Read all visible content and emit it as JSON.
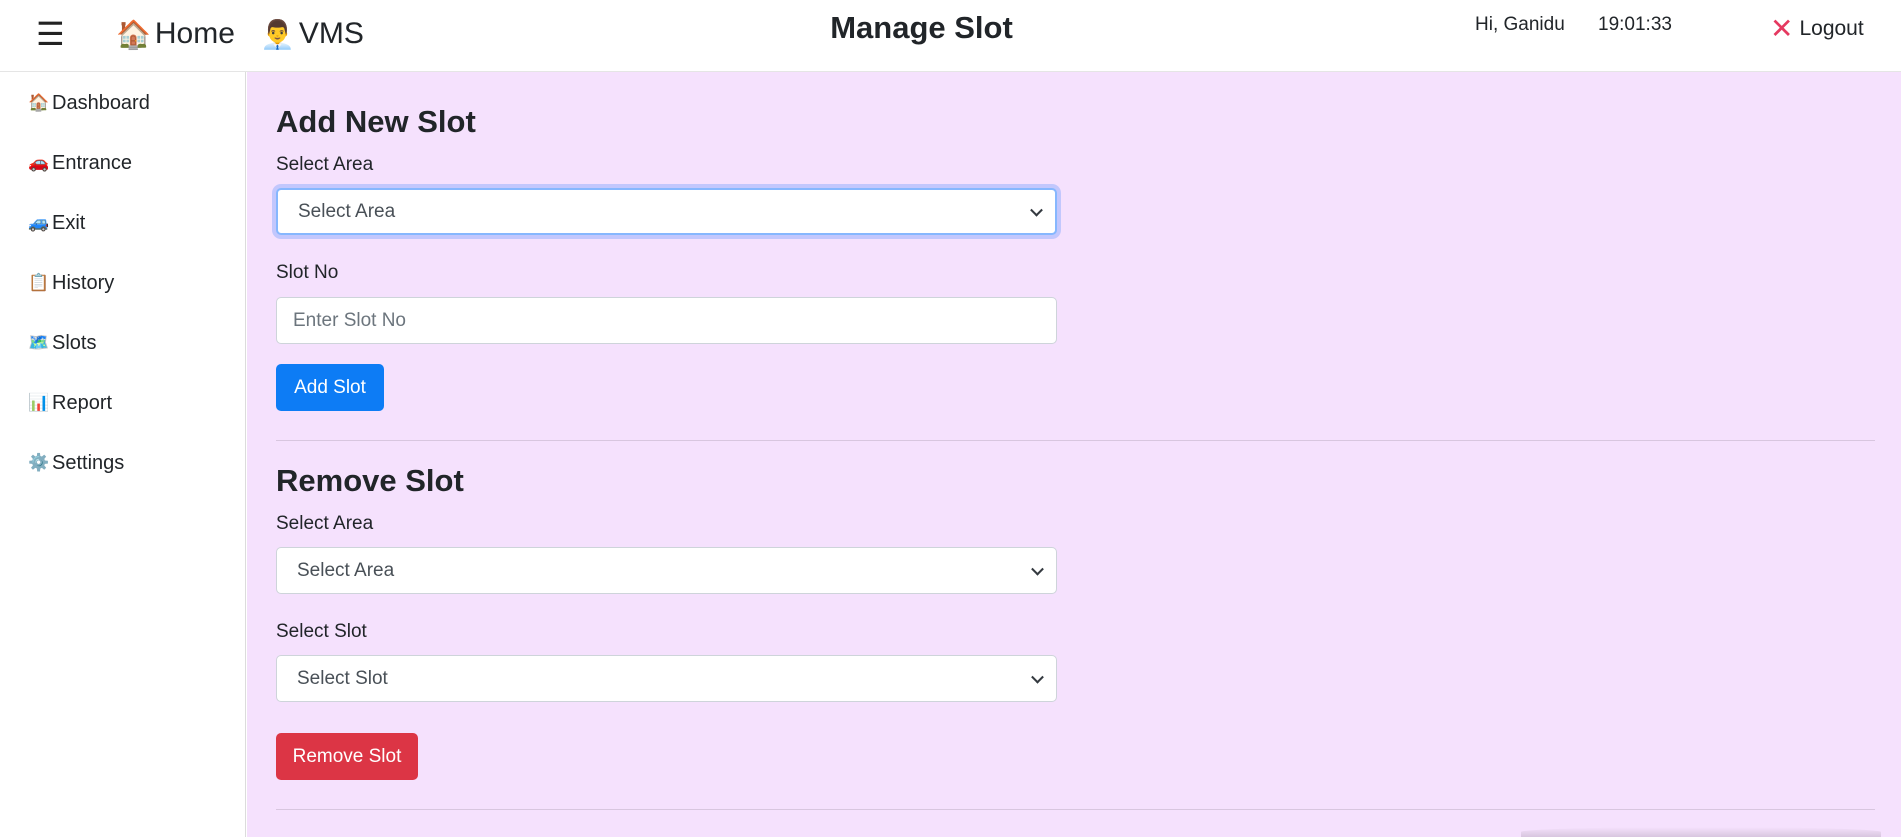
{
  "header": {
    "menu_icon": "hamburger-icon",
    "home": {
      "emoji": "🏠",
      "label": "Home"
    },
    "vms": {
      "emoji": "👨‍💼",
      "label": "VMS"
    },
    "title": "Manage Slot",
    "greeting": "Hi, Ganidu",
    "clock": "19:01:33",
    "logout": {
      "icon": "❌",
      "label": "Logout"
    }
  },
  "sidebar": {
    "items": [
      {
        "emoji": "🏠",
        "label": "Dashboard"
      },
      {
        "emoji": "🚗",
        "label": "Entrance"
      },
      {
        "emoji": "🚙",
        "label": "Exit"
      },
      {
        "emoji": "📋",
        "label": "History"
      },
      {
        "emoji": "🗺️",
        "label": "Slots"
      },
      {
        "emoji": "📊",
        "label": "Report"
      },
      {
        "emoji": "⚙️",
        "label": "Settings"
      }
    ]
  },
  "add_slot": {
    "title": "Add New Slot",
    "area_label": "Select Area",
    "area_value": "Select Area",
    "slot_label": "Slot No",
    "slot_placeholder": "Enter Slot No",
    "button": "Add Slot"
  },
  "remove_slot": {
    "title": "Remove Slot",
    "area_label": "Select Area",
    "area_value": "Select Area",
    "slot_label": "Select Slot",
    "slot_value": "Select Slot",
    "button": "Remove Slot"
  },
  "colors": {
    "main_background": "#f5e1fd",
    "primary": "#0d7cf5",
    "danger": "#dc3545",
    "logout_icon": "#e53960"
  }
}
